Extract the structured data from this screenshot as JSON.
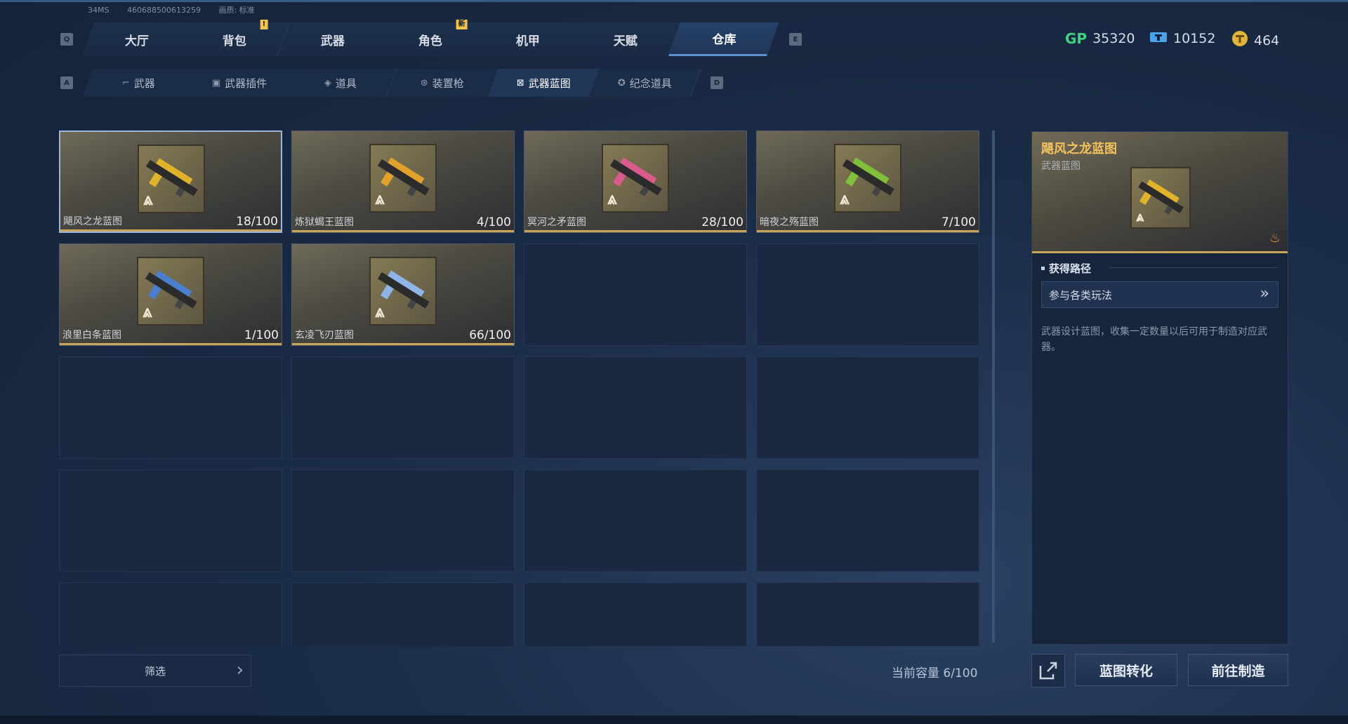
{
  "system": {
    "ping": "34MS",
    "uid": "460688500613259",
    "quality": "画质: 标准"
  },
  "key_hints": {
    "main_left": "Q",
    "main_right": "E",
    "sub_left": "A",
    "sub_right": "D"
  },
  "main_tabs": [
    {
      "label": "大厅",
      "badge": ""
    },
    {
      "label": "背包",
      "badge": "!"
    },
    {
      "label": "武器",
      "badge": ""
    },
    {
      "label": "角色",
      "badge": "新"
    },
    {
      "label": "机甲",
      "badge": ""
    },
    {
      "label": "天赋",
      "badge": ""
    },
    {
      "label": "仓库",
      "badge": "",
      "active": true
    }
  ],
  "currencies": [
    {
      "icon": "gp-coin-icon",
      "symbol": "GP",
      "value": "35320",
      "color": "#3fd17f"
    },
    {
      "icon": "ticket-icon",
      "symbol": "券",
      "value": "10152",
      "color": "#4aa3e8"
    },
    {
      "icon": "gold-coin-icon",
      "symbol": "T",
      "value": "464",
      "color": "#e3b43c"
    }
  ],
  "sub_tabs": [
    {
      "label": "武器",
      "icon": "gun-icon"
    },
    {
      "label": "武器插件",
      "icon": "chip-icon"
    },
    {
      "label": "道具",
      "icon": "grenade-icon"
    },
    {
      "label": "装置枪",
      "icon": "device-gun-icon"
    },
    {
      "label": "武器蓝图",
      "icon": "blueprint-icon",
      "active": true
    },
    {
      "label": "纪念道具",
      "icon": "medal-icon"
    }
  ],
  "items": [
    {
      "name": "飓风之龙蓝图",
      "count": "18/100",
      "accent": "#e0b32b",
      "selected": true
    },
    {
      "name": "炼狱蝎王蓝图",
      "count": "4/100",
      "accent": "#e2a12a"
    },
    {
      "name": "冥河之矛蓝图",
      "count": "28/100",
      "accent": "#d95a8c"
    },
    {
      "name": "暗夜之殇蓝图",
      "count": "7/100",
      "accent": "#7fbf3a"
    },
    {
      "name": "浪里白条蓝图",
      "count": "1/100",
      "accent": "#4a7fd0"
    },
    {
      "name": "玄凌飞刃蓝图",
      "count": "66/100",
      "accent": "#8fb4e8"
    }
  ],
  "filter": {
    "label": "筛选"
  },
  "capacity": "当前容量 6/100",
  "detail": {
    "title": "飓风之龙蓝图",
    "subtitle": "武器蓝图",
    "section": "获得路径",
    "route": "参与各类玩法",
    "description": "武器设计蓝图，收集一定数量以后可用于制造对应武器。"
  },
  "buttons": {
    "convert": "蓝图转化",
    "craft": "前往制造"
  }
}
